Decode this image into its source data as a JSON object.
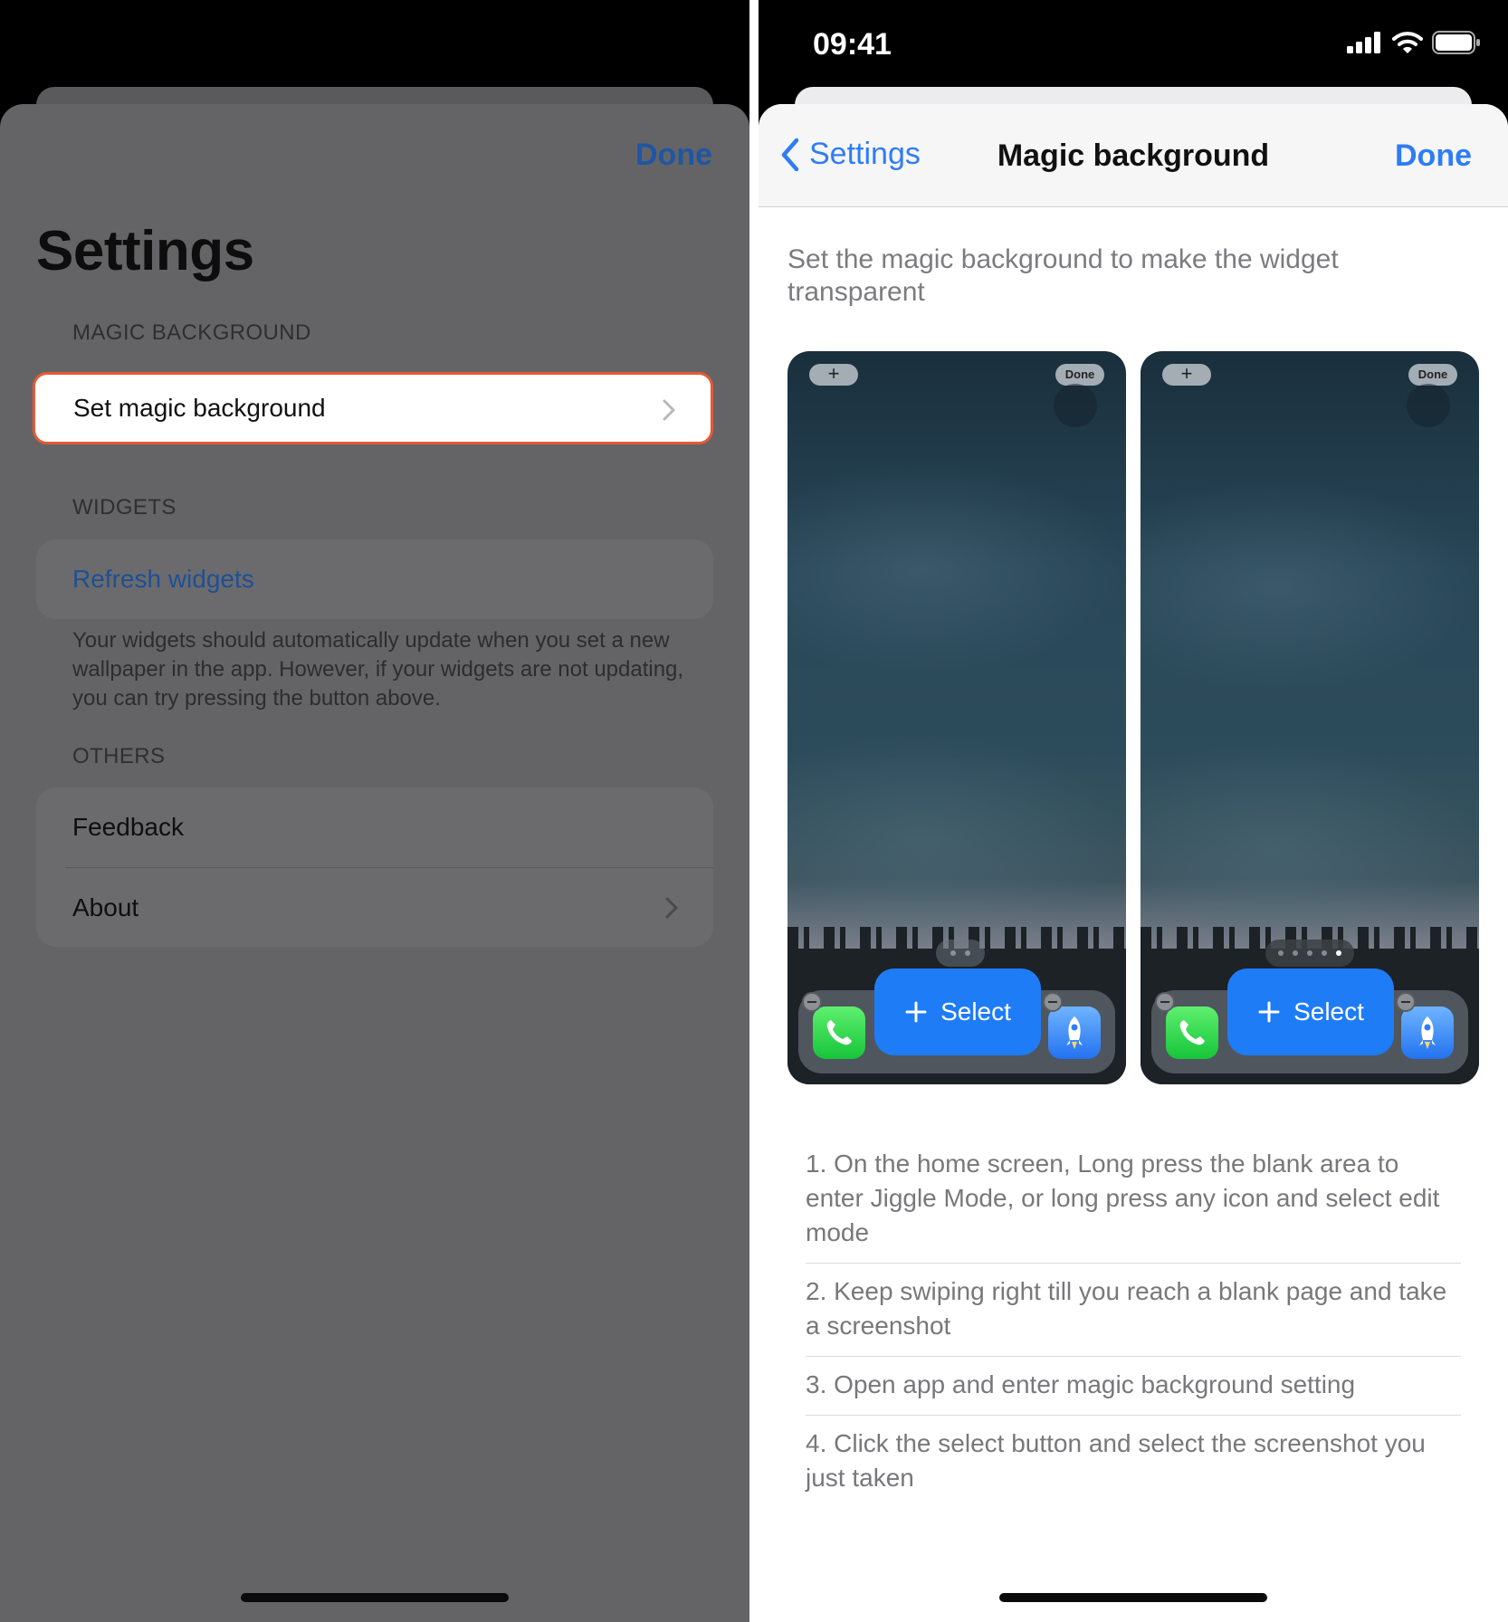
{
  "left": {
    "done_label": "Done",
    "title": "Settings",
    "sections": {
      "magic_header": "MAGIC BACKGROUND",
      "magic_item": "Set magic background",
      "widgets_header": "WIDGETS",
      "refresh_item": "Refresh widgets",
      "widgets_note": "Your widgets should automatically update when you set a new wallpaper in the app. However, if your widgets are not updating, you can try pressing the button above.",
      "others_header": "OTHERS",
      "feedback_item": "Feedback",
      "about_item": "About"
    },
    "highlight_color": "#e55a35"
  },
  "right": {
    "status_time": "09:41",
    "nav": {
      "back_label": "Settings",
      "title": "Magic background",
      "done_label": "Done"
    },
    "intro": "Set the magic background to make the widget transparent",
    "previews": [
      {
        "plus": "+",
        "done": "Done",
        "select": "Select",
        "page_dots": 2
      },
      {
        "plus": "+",
        "done": "Done",
        "select": "Select",
        "page_dots": 5
      }
    ],
    "steps": [
      "1. On the home screen, Long press the blank area to enter Jiggle Mode, or long press any icon and select edit mode",
      "2. Keep swiping right till you reach a blank page and take a screenshot",
      "3. Open app and enter magic background setting",
      "4. Click the select button and select the screenshot you just taken"
    ],
    "accent_color": "#2f7cf5"
  }
}
